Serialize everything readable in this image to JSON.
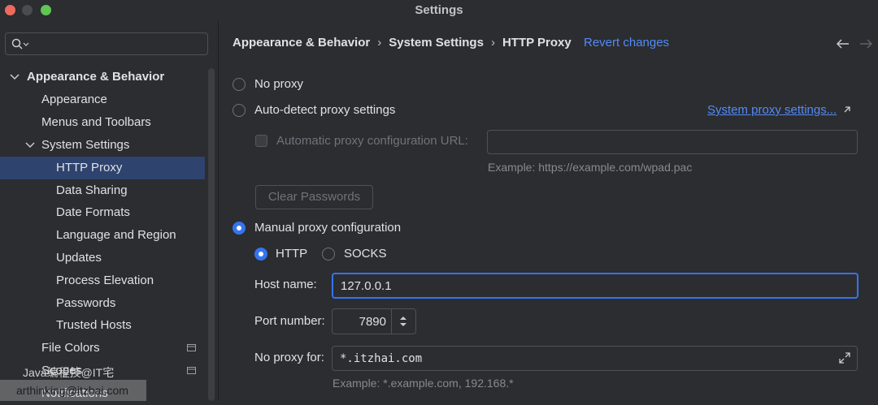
{
  "window": {
    "title": "Settings"
  },
  "sidebar": {
    "items": [
      {
        "label": "Appearance & Behavior",
        "level": 0,
        "expanded": true
      },
      {
        "label": "Appearance",
        "level": 1
      },
      {
        "label": "Menus and Toolbars",
        "level": 1
      },
      {
        "label": "System Settings",
        "level": 1,
        "expanded": true
      },
      {
        "label": "HTTP Proxy",
        "level": 2,
        "selected": true
      },
      {
        "label": "Data Sharing",
        "level": 2
      },
      {
        "label": "Date Formats",
        "level": 2
      },
      {
        "label": "Language and Region",
        "level": 2
      },
      {
        "label": "Updates",
        "level": 2
      },
      {
        "label": "Process Elevation",
        "level": 2
      },
      {
        "label": "Passwords",
        "level": 2
      },
      {
        "label": "Trusted Hosts",
        "level": 2
      },
      {
        "label": "File Colors",
        "level": 1
      },
      {
        "label": "Scopes",
        "level": 1
      },
      {
        "label": "Notifications",
        "level": 1
      }
    ],
    "watermark": "Java编程技@IT宅",
    "watermark2": "arthinking@itzhai.com"
  },
  "breadcrumb": [
    "Appearance & Behavior",
    "System Settings",
    "HTTP Proxy"
  ],
  "revert_label": "Revert changes",
  "proxy": {
    "no_proxy": "No proxy",
    "auto_detect": "Auto-detect proxy settings",
    "system_link": "System proxy settings...",
    "auto_url_label": "Automatic proxy configuration URL:",
    "auto_url_value": "",
    "auto_url_example": "Example: https://example.com/wpad.pac",
    "clear_passwords": "Clear Passwords",
    "manual": "Manual proxy configuration",
    "http": "HTTP",
    "socks": "SOCKS",
    "host_label": "Host name:",
    "host_value": "127.0.0.1",
    "port_label": "Port number:",
    "port_value": "7890",
    "noproxy_label": "No proxy for:",
    "noproxy_value": "*.itzhai.com",
    "noproxy_example": "Example: *.example.com, 192.168.*"
  },
  "colors": {
    "accent": "#3574f0",
    "link": "#548af7",
    "selection": "#2e436e"
  }
}
